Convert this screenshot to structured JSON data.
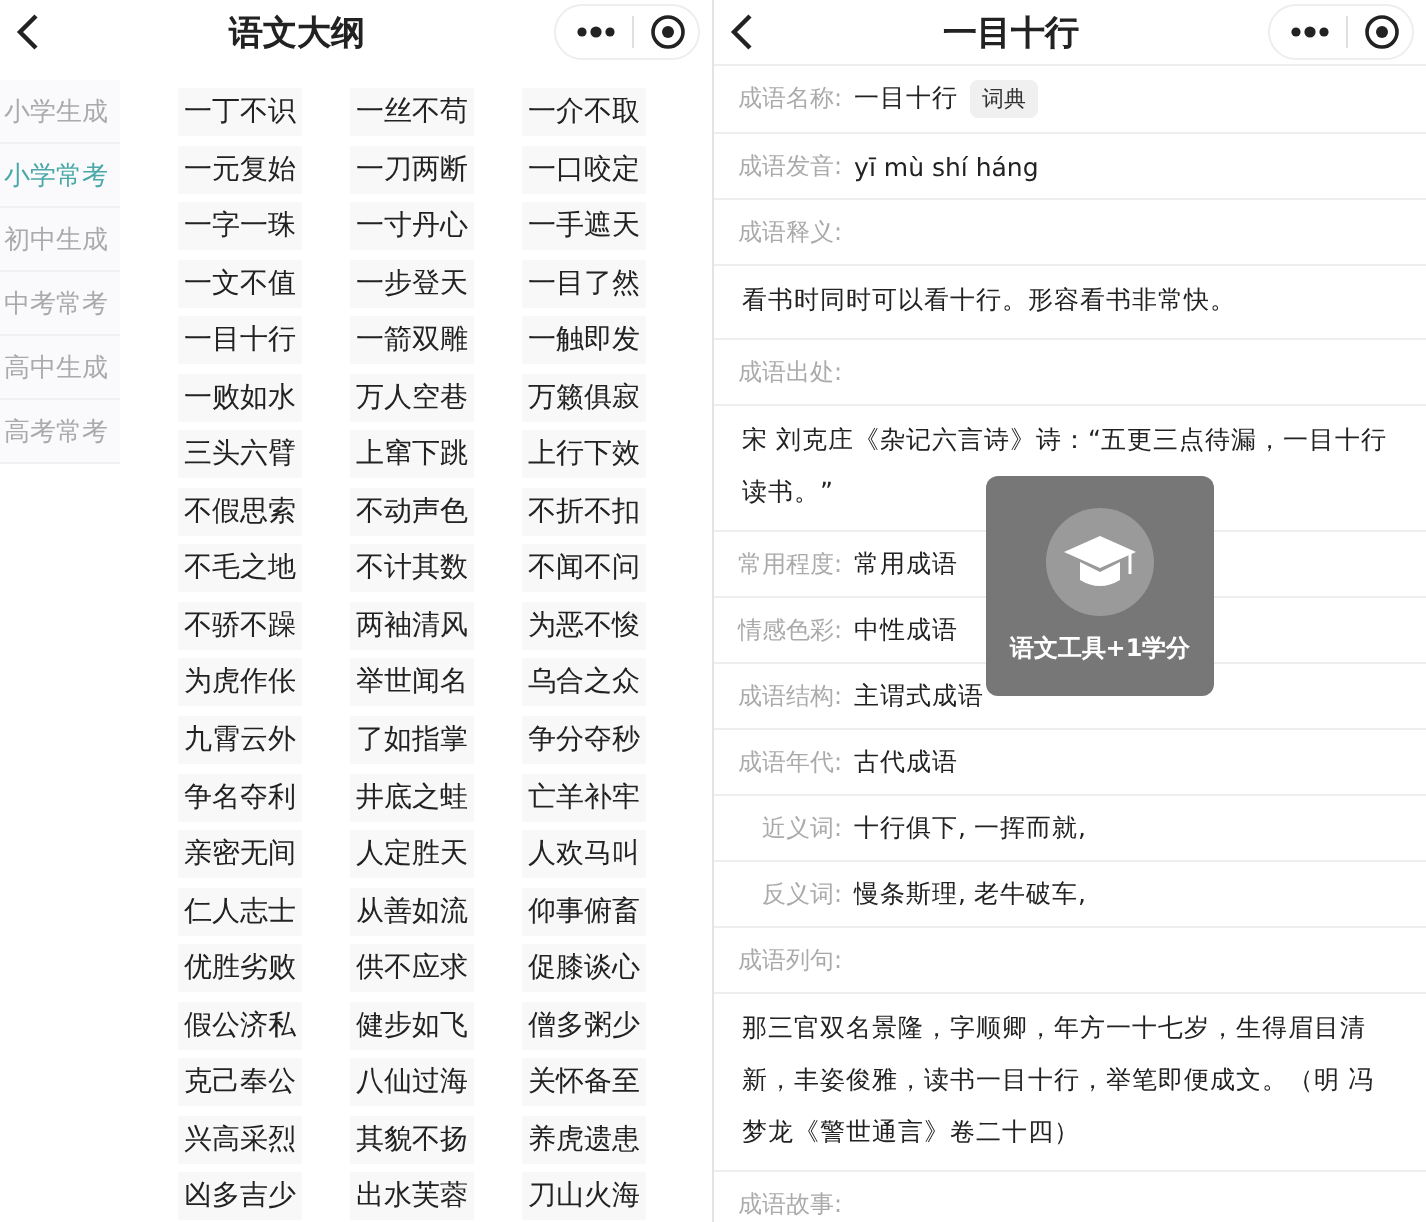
{
  "left": {
    "title": "语文大纲",
    "sidebar": [
      {
        "label": "小学生成",
        "selected": false
      },
      {
        "label": "小学常考",
        "selected": true
      },
      {
        "label": "初中生成",
        "selected": false
      },
      {
        "label": "中考常考",
        "selected": false
      },
      {
        "label": "高中生成",
        "selected": false
      },
      {
        "label": "高考常考",
        "selected": false
      }
    ],
    "idioms": [
      "一丁不识",
      "一丝不苟",
      "一介不取",
      "一元复始",
      "一刀两断",
      "一口咬定",
      "一字一珠",
      "一寸丹心",
      "一手遮天",
      "一文不值",
      "一步登天",
      "一目了然",
      "一目十行",
      "一箭双雕",
      "一触即发",
      "一败如水",
      "万人空巷",
      "万籁俱寂",
      "三头六臂",
      "上窜下跳",
      "上行下效",
      "不假思索",
      "不动声色",
      "不折不扣",
      "不毛之地",
      "不计其数",
      "不闻不问",
      "不骄不躁",
      "两袖清风",
      "为恶不悛",
      "为虎作伥",
      "举世闻名",
      "乌合之众",
      "九霄云外",
      "了如指掌",
      "争分夺秒",
      "争名夺利",
      "井底之蛙",
      "亡羊补牢",
      "亲密无间",
      "人定胜天",
      "人欢马叫",
      "仁人志士",
      "从善如流",
      "仰事俯畜",
      "优胜劣败",
      "供不应求",
      "促膝谈心",
      "假公济私",
      "健步如飞",
      "僧多粥少",
      "克己奉公",
      "八仙过海",
      "关怀备至",
      "兴高采烈",
      "其貌不扬",
      "养虎遗患",
      "凶多吉少",
      "出水芙蓉",
      "刀山火海"
    ]
  },
  "right": {
    "title": "一目十行",
    "fields": [
      {
        "kind": "inline",
        "label": "成语名称:",
        "value": "一目十行",
        "tag": "词典"
      },
      {
        "kind": "inline",
        "label": "成语发音:",
        "value": "yī mù shí háng"
      },
      {
        "kind": "block",
        "label": "成语释义:",
        "text": "看书时同时可以看十行。形容看书非常快。"
      },
      {
        "kind": "block",
        "label": "成语出处:",
        "text": "宋 刘克庄《杂记六言诗》诗：“五更三点待漏，一目十行读书。”"
      },
      {
        "kind": "inline",
        "label": "常用程度:",
        "value": "常用成语"
      },
      {
        "kind": "inline",
        "label": "情感色彩:",
        "value": "中性成语"
      },
      {
        "kind": "inline",
        "label": "成语结构:",
        "value": "主谓式成语"
      },
      {
        "kind": "inline",
        "label": "成语年代:",
        "value": "古代成语"
      },
      {
        "kind": "sub",
        "label": "近义词:",
        "value": "十行俱下, 一挥而就,"
      },
      {
        "kind": "sub",
        "label": "反义词:",
        "value": "慢条斯理, 老牛破车,"
      },
      {
        "kind": "block",
        "label": "成语列句:",
        "text": "那三官双名景隆，字顺卿，年方一十七岁，生得眉目清新，丰姿俊雅，读书一目十行，举笔即便成文。（明 冯梦龙《警世通言》卷二十四）"
      },
      {
        "kind": "label",
        "label": "成语故事:"
      }
    ],
    "toast": "语文工具+1学分"
  }
}
